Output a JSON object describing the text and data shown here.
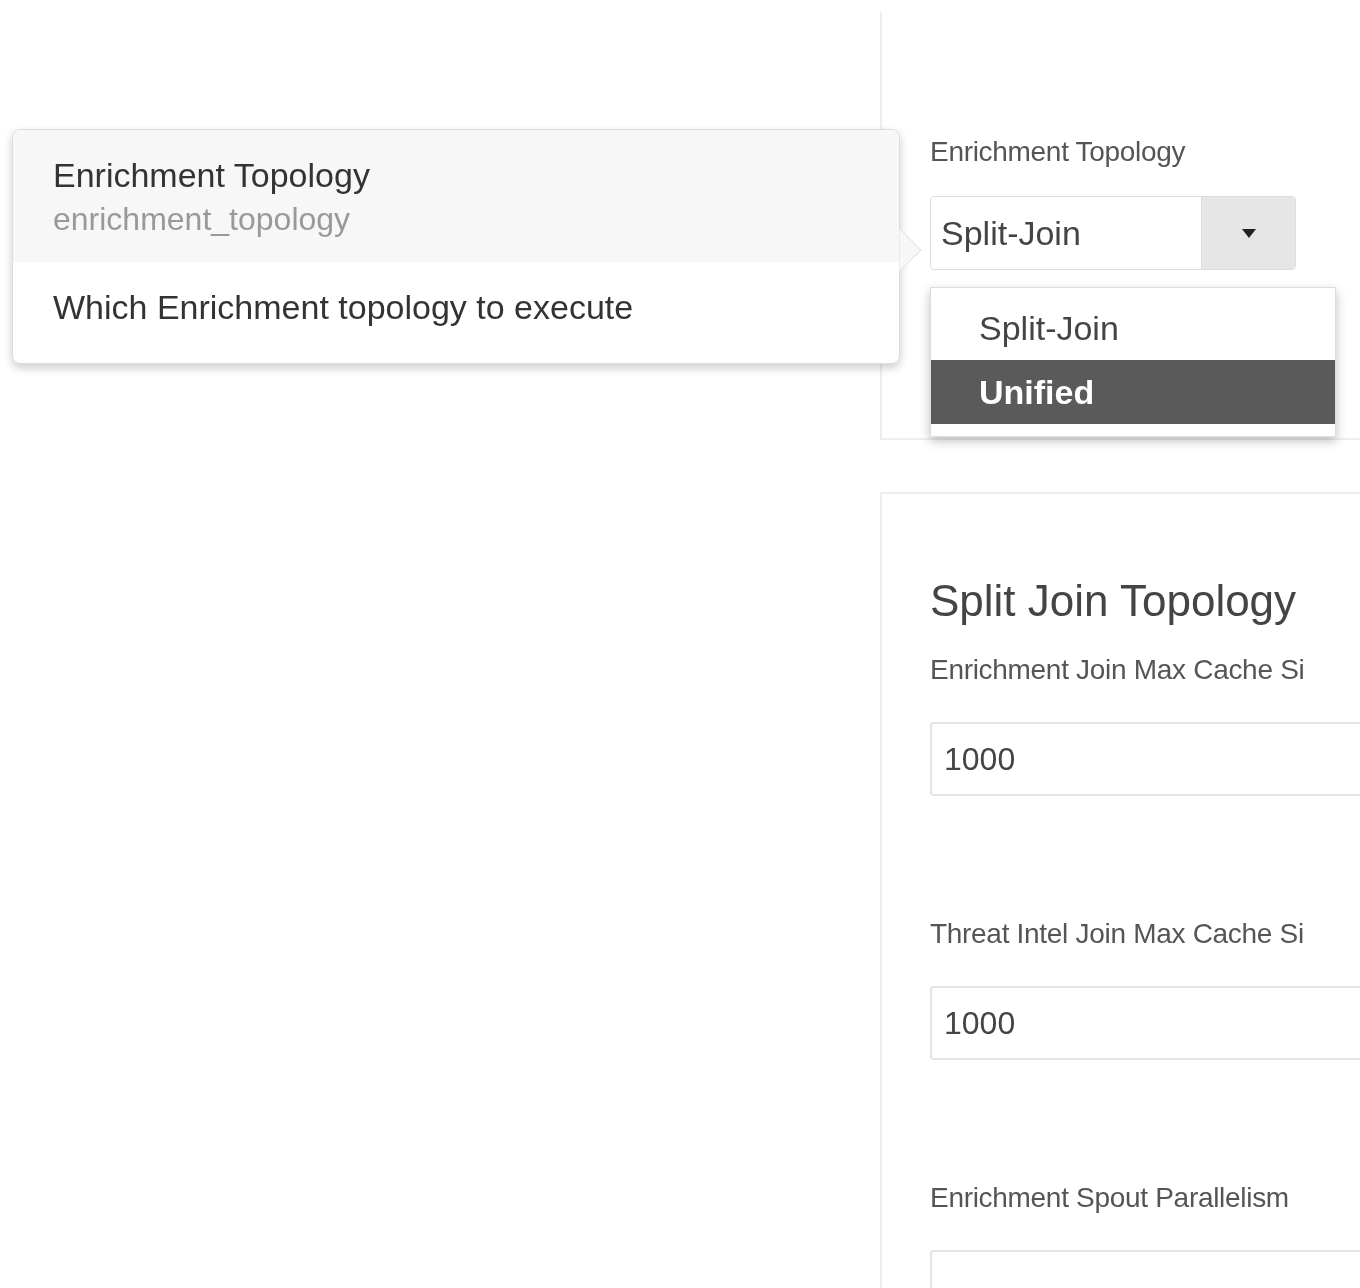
{
  "popover": {
    "title": "Enrichment Topology",
    "key": "enrichment_topology",
    "description": "Which Enrichment topology to execute"
  },
  "topology_panel": {
    "label": "Enrichment Topology",
    "select": {
      "value": "Split-Join",
      "expanded": true
    },
    "options": [
      {
        "label": "Split-Join",
        "selected": false
      },
      {
        "label": "Unified",
        "selected": true
      }
    ]
  },
  "split_join_panel": {
    "heading": "Split Join Topology",
    "fields": [
      {
        "label": "Enrichment Join Max Cache Si",
        "value": "1000"
      },
      {
        "label": "Threat Intel Join Max Cache Si",
        "value": "1000"
      },
      {
        "label": "Enrichment Spout Parallelism"
      }
    ]
  }
}
